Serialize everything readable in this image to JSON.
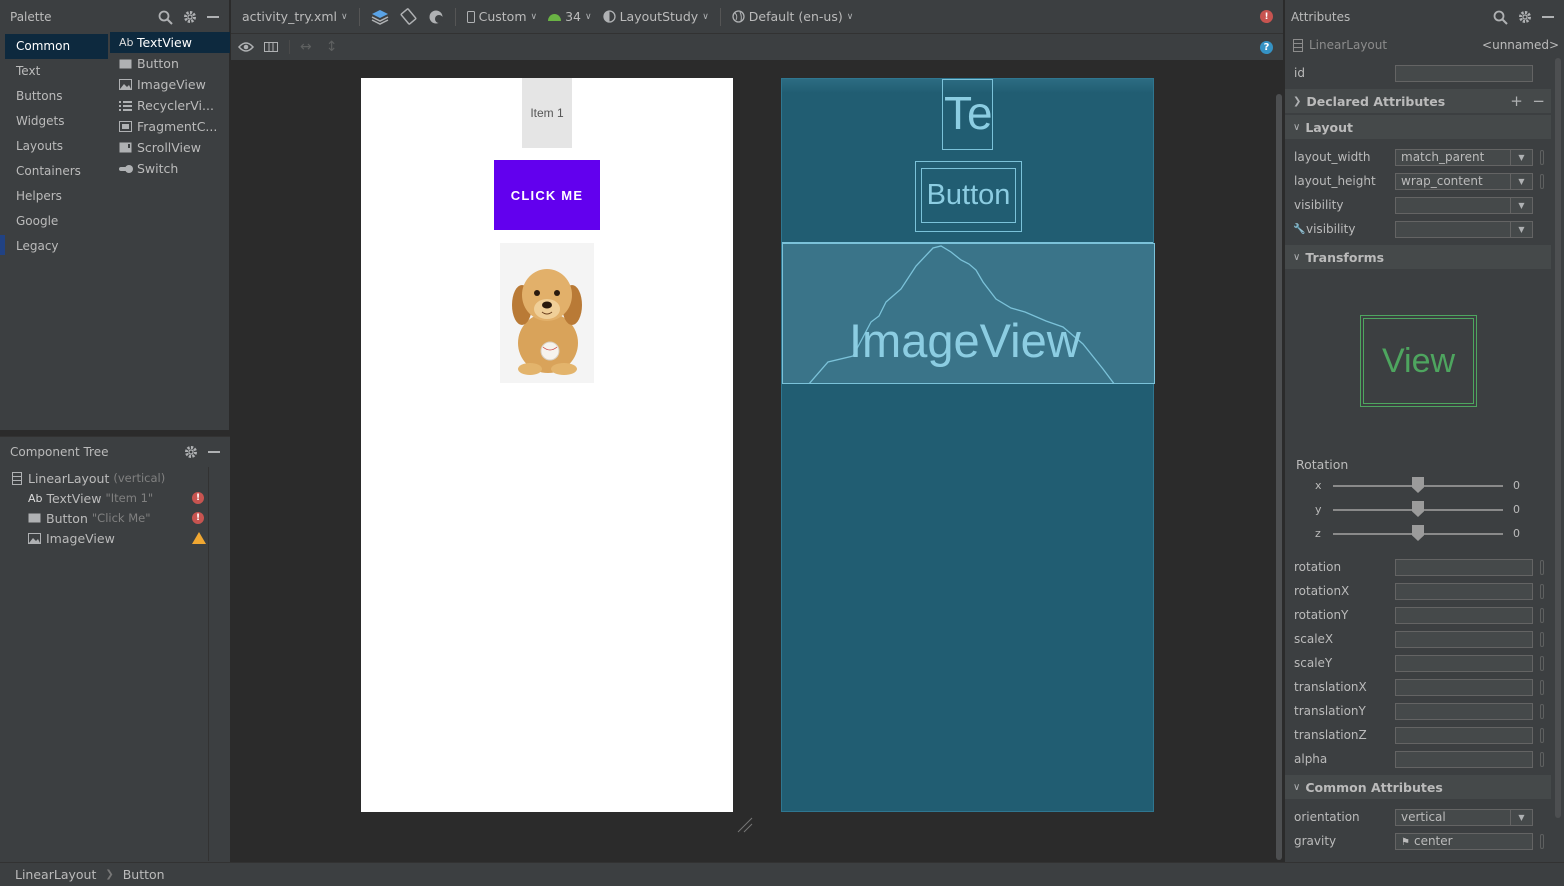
{
  "palette": {
    "title": "Palette",
    "categories": [
      "Common",
      "Text",
      "Buttons",
      "Widgets",
      "Layouts",
      "Containers",
      "Helpers",
      "Google",
      "Legacy"
    ],
    "selected_category": "Common",
    "items": [
      {
        "icon": "textview-icon",
        "label": "TextView"
      },
      {
        "icon": "button-icon",
        "label": "Button"
      },
      {
        "icon": "imageview-icon",
        "label": "ImageView"
      },
      {
        "icon": "recyclerview-icon",
        "label": "RecyclerVi..."
      },
      {
        "icon": "fragment-icon",
        "label": "FragmentC..."
      },
      {
        "icon": "scrollview-icon",
        "label": "ScrollView"
      },
      {
        "icon": "switch-icon",
        "label": "Switch"
      }
    ]
  },
  "component_tree": {
    "title": "Component Tree",
    "rows": [
      {
        "label": "LinearLayout",
        "sub": "(vertical)",
        "status": "none"
      },
      {
        "label": "TextView",
        "sub": "\"Item 1\"",
        "status": "error"
      },
      {
        "label": "Button",
        "sub": "\"Click Me\"",
        "status": "error"
      },
      {
        "label": "ImageView",
        "sub": "",
        "status": "warning"
      }
    ]
  },
  "toolbar": {
    "file": "activity_try.xml",
    "device": "Custom",
    "api": "34",
    "theme": "LayoutStudy",
    "locale": "Default (en-us)"
  },
  "design": {
    "textview_text": "Item 1",
    "button_text": "CLICK ME",
    "image_alt": "puppy"
  },
  "blueprint": {
    "textview_text": "Te",
    "button_text": "Button",
    "imageview_text": "ImageView"
  },
  "attributes": {
    "title": "Attributes",
    "component": "LinearLayout",
    "component_id_hint": "<unnamed>",
    "id_label": "id",
    "id_value": "",
    "sections": {
      "declared": "Declared Attributes",
      "layout": "Layout",
      "transforms": "Transforms",
      "common": "Common Attributes"
    },
    "layout_rows": [
      {
        "label": "layout_width",
        "value": "match_parent"
      },
      {
        "label": "layout_height",
        "value": "wrap_content"
      },
      {
        "label": "visibility",
        "value": ""
      },
      {
        "label": "visibility",
        "value": ""
      }
    ],
    "transform_preview": "View",
    "rotation_label": "Rotation",
    "rotation_sliders": [
      {
        "axis": "x",
        "value": "0"
      },
      {
        "axis": "y",
        "value": "0"
      },
      {
        "axis": "z",
        "value": "0"
      }
    ],
    "transform_rows": [
      "rotation",
      "rotationX",
      "rotationY",
      "scaleX",
      "scaleY",
      "translationX",
      "translationY",
      "translationZ",
      "alpha"
    ],
    "common_rows": [
      {
        "label": "orientation",
        "value": "vertical"
      },
      {
        "label": "gravity",
        "value": "center"
      }
    ]
  },
  "breadcrumb": [
    "LinearLayout",
    "Button"
  ],
  "colors": {
    "button_purple": "#6200ee",
    "blueprint_bg": "#215d72",
    "error_red": "#c75450",
    "warning_orange": "#f0a732",
    "selection_blue": "#0d293e"
  }
}
